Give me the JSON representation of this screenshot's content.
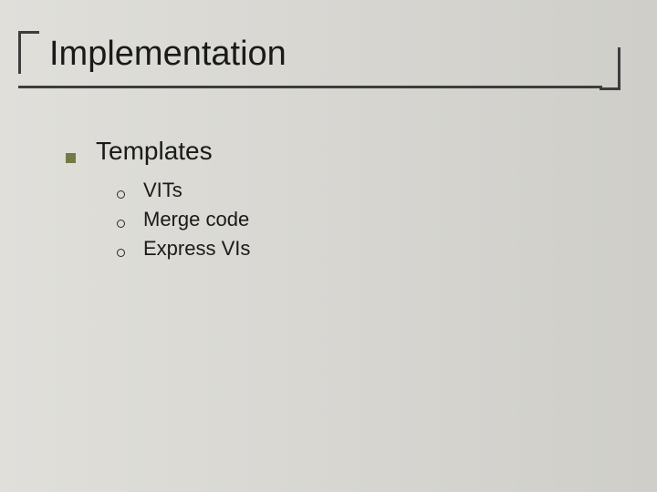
{
  "title": "Implementation",
  "body": {
    "level1": {
      "label": "Templates",
      "sub": [
        {
          "label": "VITs"
        },
        {
          "label": "Merge code"
        },
        {
          "label": "Express VIs"
        }
      ]
    }
  }
}
